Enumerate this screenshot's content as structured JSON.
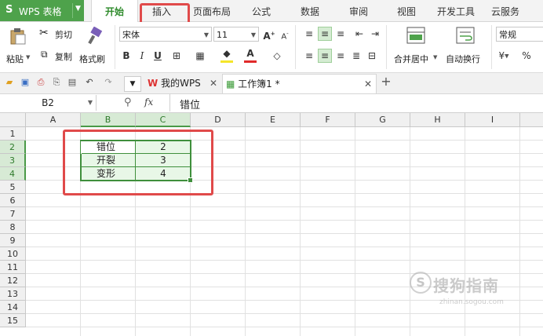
{
  "app": {
    "logo": "S",
    "title": "WPS 表格"
  },
  "tabs": [
    {
      "label": "开始",
      "active": true
    },
    {
      "label": "插入",
      "active": false
    },
    {
      "label": "页面布局",
      "active": false
    },
    {
      "label": "公式",
      "active": false
    },
    {
      "label": "数据",
      "active": false
    },
    {
      "label": "审阅",
      "active": false
    },
    {
      "label": "视图",
      "active": false
    },
    {
      "label": "开发工具",
      "active": false
    },
    {
      "label": "云服务",
      "active": false
    }
  ],
  "ribbon": {
    "paste": "粘贴",
    "cut": "剪切",
    "copy": "复制",
    "format_painter": "格式刷",
    "font_name": "宋体",
    "font_size": "11",
    "merge_center": "合并居中",
    "wrap_text": "自动换行",
    "number_format": "常规",
    "percent": "%"
  },
  "doc_tabs": [
    {
      "label": "我的WPS",
      "active": false
    },
    {
      "label": "工作簿1 *",
      "active": true
    }
  ],
  "formula_bar": {
    "cell_ref": "B2",
    "fx": "fx",
    "content": "错位"
  },
  "columns": [
    "A",
    "B",
    "C",
    "D",
    "E",
    "F",
    "G",
    "H",
    "I"
  ],
  "rows": [
    "1",
    "2",
    "3",
    "4",
    "5",
    "6",
    "7",
    "8",
    "9",
    "10",
    "11",
    "12",
    "13",
    "14",
    "15"
  ],
  "cells": [
    {
      "ref": "B2",
      "value": "错位"
    },
    {
      "ref": "C2",
      "value": "2"
    },
    {
      "ref": "B3",
      "value": "开裂"
    },
    {
      "ref": "C3",
      "value": "3"
    },
    {
      "ref": "B4",
      "value": "变形"
    },
    {
      "ref": "C4",
      "value": "4"
    }
  ],
  "watermark": {
    "text": "搜狗指南",
    "sub": "zhinan.sogou.com"
  },
  "colors": {
    "accent": "#4ea24b",
    "highlight": "#e04a4a",
    "selection": "#3f8f3c"
  }
}
